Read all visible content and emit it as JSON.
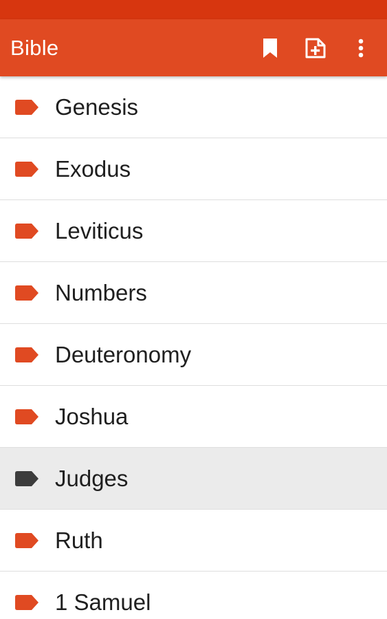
{
  "app": {
    "title": "Bible",
    "accent": "#e04a22",
    "status_bar_color": "#d7360f",
    "actions": [
      {
        "icon": "bookmark-icon"
      },
      {
        "icon": "add-note-icon"
      },
      {
        "icon": "more-vert-icon"
      }
    ]
  },
  "books": [
    {
      "label": "Genesis",
      "selected": false
    },
    {
      "label": "Exodus",
      "selected": false
    },
    {
      "label": "Leviticus",
      "selected": false
    },
    {
      "label": "Numbers",
      "selected": false
    },
    {
      "label": "Deuteronomy",
      "selected": false
    },
    {
      "label": "Joshua",
      "selected": false
    },
    {
      "label": "Judges",
      "selected": true
    },
    {
      "label": "Ruth",
      "selected": false
    },
    {
      "label": "1 Samuel",
      "selected": false
    }
  ],
  "colors": {
    "tag": "#e04a22",
    "tag_selected": "#3c3c3c",
    "selected_row": "#ebebeb"
  }
}
